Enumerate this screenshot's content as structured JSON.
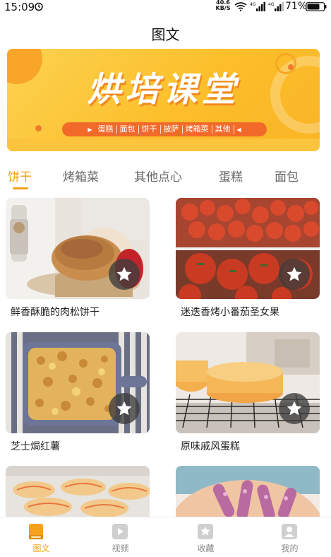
{
  "status_bar": {
    "time": "15:09",
    "net_speed": "40.6\nKB/S",
    "net_speed_value": "40.6",
    "net_speed_unit": "KB/S",
    "battery": "71%"
  },
  "header": {
    "title": "图文"
  },
  "banner": {
    "title": "烘培课堂",
    "categories": [
      "蛋糕",
      "面包",
      "饼干",
      "披萨",
      "烤箱菜",
      "其他"
    ]
  },
  "tabs": [
    {
      "label": "饼干",
      "active": true
    },
    {
      "label": "烤箱菜",
      "active": false
    },
    {
      "label": "其他点心",
      "active": false
    },
    {
      "label": "蛋糕",
      "active": false
    },
    {
      "label": "面包",
      "active": false
    }
  ],
  "cards": [
    {
      "title": "鲜香酥脆的肉松饼干"
    },
    {
      "title": "迷迭香烤小番茄圣女果"
    },
    {
      "title": "芝士焗红薯"
    },
    {
      "title": "原味戚风蛋糕"
    },
    {
      "title": ""
    },
    {
      "title": ""
    }
  ],
  "bottom_nav": [
    {
      "label": "图文",
      "icon": "book-icon",
      "active": true
    },
    {
      "label": "视频",
      "icon": "play-icon",
      "active": false
    },
    {
      "label": "收藏",
      "icon": "star-icon",
      "active": false
    },
    {
      "label": "我的",
      "icon": "user-icon",
      "active": false
    }
  ],
  "colors": {
    "accent": "#f4a11d",
    "banner_pill": "#f26a2a",
    "inactive_text": "#888888"
  }
}
